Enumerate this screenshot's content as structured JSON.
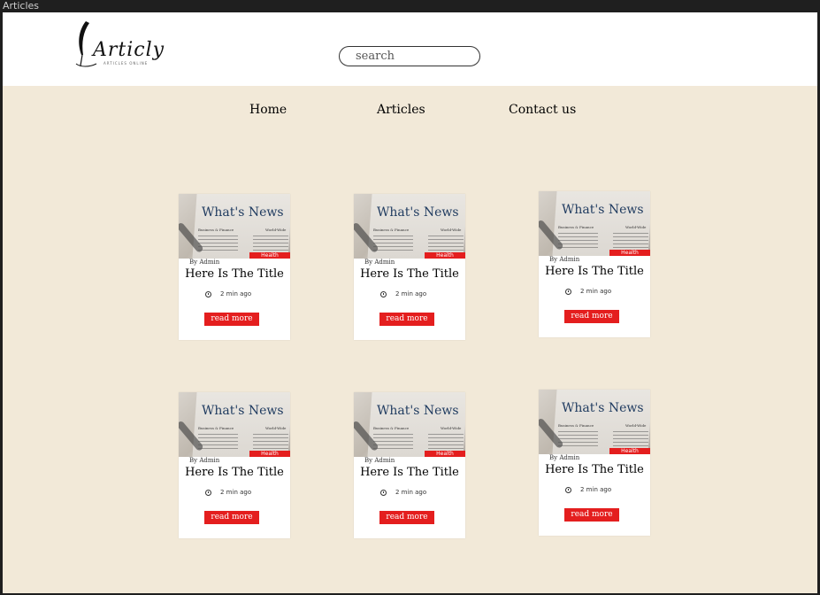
{
  "window": {
    "title": "Articles"
  },
  "header": {
    "logo_text": "Articly",
    "logo_sub": "ARTICLES ONLINE",
    "search_placeholder": "search"
  },
  "nav": [
    {
      "label": "Home"
    },
    {
      "label": "Articles"
    },
    {
      "label": "Contact us"
    }
  ],
  "articles": [
    {
      "image_headline": "What's News",
      "image_section_left": "Business & Finance",
      "image_section_right": "World-Wide",
      "category": "Health",
      "author": "By Admin",
      "title": "Here Is The Title",
      "time": "2 min ago",
      "button": "read more"
    },
    {
      "image_headline": "What's News",
      "image_section_left": "Business & Finance",
      "image_section_right": "World-Wide",
      "category": "Health",
      "author": "By Admin",
      "title": "Here Is The Title",
      "time": "2 min ago",
      "button": "read more"
    },
    {
      "image_headline": "What's News",
      "image_section_left": "Business & Finance",
      "image_section_right": "World-Wide",
      "category": "Health",
      "author": "By Admin",
      "title": "Here Is The Title",
      "time": "2 min ago",
      "button": "read more"
    },
    {
      "image_headline": "What's News",
      "image_section_left": "Business & Finance",
      "image_section_right": "World-Wide",
      "category": "Health",
      "author": "By Admin",
      "title": "Here Is The Title",
      "time": "2 min ago",
      "button": "read more"
    },
    {
      "image_headline": "What's News",
      "image_section_left": "Business & Finance",
      "image_section_right": "World-Wide",
      "category": "Health",
      "author": "By Admin",
      "title": "Here Is The Title",
      "time": "2 min ago",
      "button": "read more"
    },
    {
      "image_headline": "What's News",
      "image_section_left": "Business & Finance",
      "image_section_right": "World-Wide",
      "category": "Health",
      "author": "By Admin",
      "title": "Here Is The Title",
      "time": "2 min ago",
      "button": "read more"
    }
  ],
  "colors": {
    "accent": "#e41e1e",
    "page_bg": "#f2e9d8",
    "header_bg": "#ffffff"
  }
}
